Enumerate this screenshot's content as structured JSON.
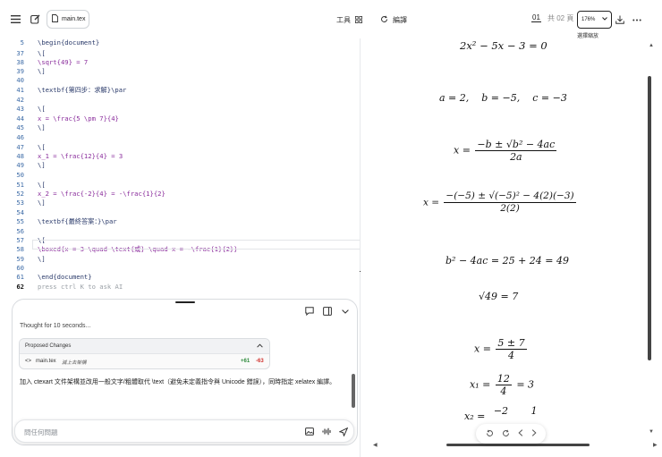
{
  "topbar": {
    "menu_icon": "menu-icon",
    "edit_icon": "edit-icon",
    "file_tab": "main.tex",
    "tools_label": "工具",
    "compile_label": "編譯",
    "page_current": "01",
    "page_total": "共 02 頁",
    "zoom_value": "176%",
    "zoom_tooltip": "選擇縮放"
  },
  "editor": {
    "lines": [
      {
        "n": "5",
        "t": "\\begin{document}",
        "kind": "code"
      },
      {
        "n": "37",
        "t": "\\[",
        "kind": "code"
      },
      {
        "n": "38",
        "t": "\\sqrt{49} = 7",
        "kind": "math"
      },
      {
        "n": "39",
        "t": "\\]",
        "kind": "code"
      },
      {
        "n": "40",
        "t": "",
        "kind": "code"
      },
      {
        "n": "41",
        "t": "\\textbf{第四步：求解}\\par",
        "kind": "code"
      },
      {
        "n": "42",
        "t": "",
        "kind": "code"
      },
      {
        "n": "43",
        "t": "\\[",
        "kind": "code"
      },
      {
        "n": "44",
        "t": "x = \\frac{5 \\pm 7}{4}",
        "kind": "math"
      },
      {
        "n": "45",
        "t": "\\]",
        "kind": "code"
      },
      {
        "n": "46",
        "t": "",
        "kind": "code"
      },
      {
        "n": "47",
        "t": "\\[",
        "kind": "code"
      },
      {
        "n": "48",
        "t": "x_1 = \\frac{12}{4} = 3",
        "kind": "math"
      },
      {
        "n": "49",
        "t": "\\]",
        "kind": "code"
      },
      {
        "n": "50",
        "t": "",
        "kind": "code"
      },
      {
        "n": "51",
        "t": "\\[",
        "kind": "code"
      },
      {
        "n": "52",
        "t": "x_2 = \\frac{-2}{4} = -\\frac{1}{2}",
        "kind": "math"
      },
      {
        "n": "53",
        "t": "\\]",
        "kind": "code"
      },
      {
        "n": "54",
        "t": "",
        "kind": "code"
      },
      {
        "n": "55",
        "t": "\\textbf{最終答案：}\\par",
        "kind": "code"
      },
      {
        "n": "56",
        "t": "",
        "kind": "code"
      },
      {
        "n": "57",
        "t": "\\[",
        "kind": "code"
      },
      {
        "n": "58",
        "t": "\\boxed{x = 3 \\quad \\text{或} \\quad x = -\\frac{1}{2}}",
        "kind": "math"
      },
      {
        "n": "59",
        "t": "\\]",
        "kind": "code"
      },
      {
        "n": "60",
        "t": "",
        "kind": "code"
      },
      {
        "n": "61",
        "t": "\\end{document}",
        "kind": "code"
      },
      {
        "n": "62",
        "t": "press ctrl K to ask AI",
        "kind": "placeholder"
      }
    ]
  },
  "chat": {
    "thought": "Thought for 10 seconds...",
    "proposed_title": "Proposed Changes",
    "file_name": "main.tex",
    "file_status": "減上去架構",
    "added": "+61",
    "removed": "-63",
    "message": "加入 ctexart 文件架構並改用一般文字/粗體取代 \\text（避免未定義指令與 Unicode 錯誤），同時指定 xelatex 編譯。",
    "input_placeholder": "問任何問題"
  },
  "preview": {
    "eq1": "2x² − 5x − 3 = 0",
    "eq2_a": "a = 2,",
    "eq2_b": "b = −5,",
    "eq2_c": "c = −3",
    "eq3_lhs": "x =",
    "eq3_num": "−b ± √b² − 4ac",
    "eq3_den": "2a",
    "eq4_lhs": "x =",
    "eq4_num": "−(−5) ± √(−5)² − 4(2)(−3)",
    "eq4_den": "2(2)",
    "eq5": "b² − 4ac = 25 + 24 = 49",
    "eq6": "√49 = 7",
    "eq7_lhs": "x =",
    "eq7_num": "5 ± 7",
    "eq7_den": "4",
    "eq8_lhs": "x₁ =",
    "eq8_num": "12",
    "eq8_den": "4",
    "eq8_rhs": "= 3",
    "eq9_lhs": "x₂ =",
    "eq9_num": "−2",
    "eq9_rhs_num": "1"
  }
}
